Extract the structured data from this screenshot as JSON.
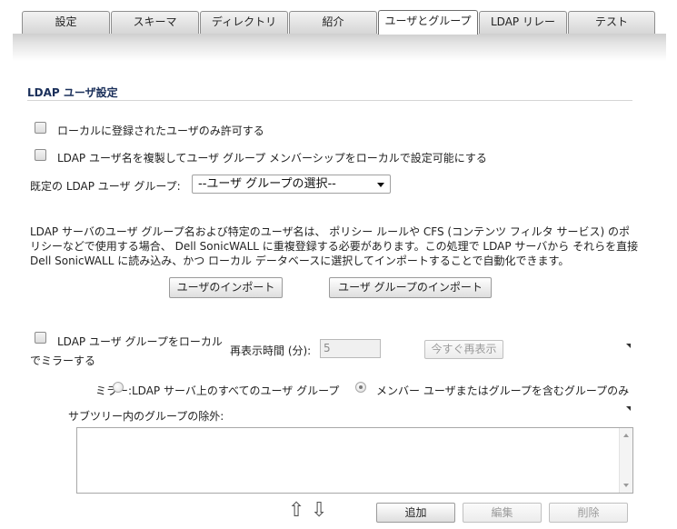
{
  "tabs": [
    {
      "label": "設定",
      "active": false
    },
    {
      "label": "スキーマ",
      "active": false
    },
    {
      "label": "ディレクトリ",
      "active": false
    },
    {
      "label": "紹介",
      "active": false
    },
    {
      "label": "ユーザとグループ",
      "active": true
    },
    {
      "label": "LDAP リレー",
      "active": false
    },
    {
      "label": "テスト",
      "active": false
    }
  ],
  "section": {
    "title": "LDAP ユーザ設定"
  },
  "options": {
    "allow_local_only": {
      "label": "ローカルに登録されたユーザのみ許可する",
      "checked": false
    },
    "replicate_membership": {
      "label": "LDAP ユーザ名を複製してユーザ グループ メンバーシップをローカルで設定可能にする",
      "checked": false
    }
  },
  "default_group": {
    "label": "既定の LDAP ユーザ グループ:",
    "selected": "--ユーザ グループの選択--"
  },
  "description": {
    "lines": [
      "LDAP サーバのユーザ グループ名および特定のユーザ名は、 ポリシー ルールや CFS (コンテンツ フィルタ サービス) のポ",
      "リシーなどで使用する場合、 Dell SonicWALL に重複登録する必要があります。この処理で LDAP サーバから それらを直接",
      "Dell SonicWALL に読み込み、かつ ローカル データベースに選択してインポートすることで自動化できます。"
    ]
  },
  "import_buttons": {
    "users": "ユーザのインポート",
    "groups": "ユーザ グループのインポート"
  },
  "mirror": {
    "checkbox_label_line1": "LDAP ユーザ グループをローカル",
    "checkbox_label_line2": "でミラーする",
    "checked": false,
    "refresh_label": "再表示時間 (分):",
    "refresh_value": "5",
    "refresh_now_button": "今すぐ再表示",
    "mirror_label": "ミラー:",
    "option_all": "LDAP サーバ上のすべてのユーザ グループ",
    "option_member": "メンバー ユーザまたはグループを含むグループのみ",
    "selected_option": "member",
    "exclude_label": "サブツリー内のグループの除外:"
  },
  "list_buttons": {
    "add": "追加",
    "edit": "編集",
    "delete": "削除"
  },
  "icons": {
    "move_up": "⇧",
    "move_down": "⇩"
  }
}
